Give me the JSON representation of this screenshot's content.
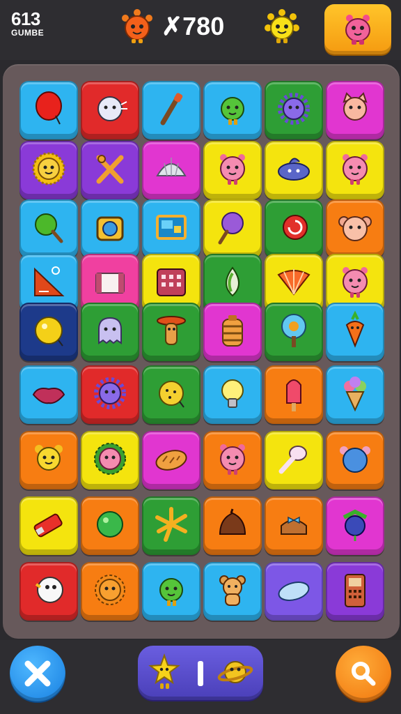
{
  "hud": {
    "score_value": "613",
    "score_caption": "GUMBE",
    "counter_text": "✗780",
    "left_mascot_icon": "orange-sun-creature-icon",
    "right_mascot_icon": "yellow-sun-creature-icon",
    "menu_icon": "pink-creature-icon"
  },
  "colors": {
    "cyan": "#2eb4f0",
    "red": "#e12a2a",
    "green": "#2e9e35",
    "magenta": "#e136d0",
    "purple": "#8a3ad8",
    "yellow": "#f4e40e",
    "orange": "#f77d12",
    "pink": "#f040a0",
    "navy": "#1d3a8a",
    "violet": "#7d57e6"
  },
  "board": {
    "rows": [
      [
        [
          "cyan",
          "balloon-icon"
        ],
        [
          "red",
          "fluffy-creature-icon"
        ],
        [
          "cyan",
          "brush-icon"
        ],
        [
          "cyan",
          "green-creature-icon"
        ],
        [
          "green",
          "purple-urchin-icon"
        ],
        [
          "magenta",
          "cat-face-icon"
        ]
      ],
      [
        [
          "purple",
          "sun-icon"
        ],
        [
          "purple",
          "crossed-sticks-icon"
        ],
        [
          "magenta",
          "shell-icon"
        ],
        [
          "yellow",
          "pink-creature-icon"
        ],
        [
          "yellow",
          "blob-creature-icon"
        ],
        [
          "yellow",
          "pink-creature-icon"
        ]
      ],
      [
        [
          "cyan",
          "green-lollipop-icon"
        ],
        [
          "cyan",
          "camera-icon"
        ],
        [
          "cyan",
          "picture-frame-icon"
        ],
        [
          "yellow",
          "purple-lollipop-icon"
        ],
        [
          "green",
          "red-snail-icon"
        ],
        [
          "orange",
          "bear-face-icon"
        ]
      ],
      [
        [
          "cyan",
          "ruler-icon"
        ],
        [
          "pink",
          "box-icon"
        ],
        [
          "yellow",
          "calculator-icon"
        ],
        [
          "green",
          "leaf-icon"
        ],
        [
          "yellow",
          "fan-icon"
        ],
        [
          "yellow",
          "pink-creature-icon"
        ]
      ],
      [
        [
          "navy",
          "yellow-ball-icon"
        ],
        [
          "green",
          "ghost-icon"
        ],
        [
          "green",
          "cowboy-icon"
        ],
        [
          "magenta",
          "barrel-icon"
        ],
        [
          "green",
          "tree-icon"
        ],
        [
          "cyan",
          "carrot-icon"
        ]
      ],
      [
        [
          "cyan",
          "lips-icon"
        ],
        [
          "red",
          "purple-urchin-icon"
        ],
        [
          "green",
          "yellow-cookie-icon"
        ],
        [
          "cyan",
          "lightbulb-icon"
        ],
        [
          "orange",
          "popsicle-icon"
        ],
        [
          "cyan",
          "ice-cream-icon"
        ]
      ],
      [
        [
          "orange",
          "yellow-creature-icon"
        ],
        [
          "yellow",
          "pink-flower-creature-icon"
        ],
        [
          "magenta",
          "bread-icon"
        ],
        [
          "orange",
          "pink-creature-icon"
        ],
        [
          "yellow",
          "spoon-icon"
        ],
        [
          "orange",
          "blue-creature-icon"
        ]
      ],
      [
        [
          "yellow",
          "battery-icon"
        ],
        [
          "orange",
          "green-ball-icon"
        ],
        [
          "green",
          "palm-leaf-icon"
        ],
        [
          "orange",
          "chestnut-icon"
        ],
        [
          "orange",
          "hat-icon"
        ],
        [
          "magenta",
          "berry-icon"
        ]
      ],
      [
        [
          "red",
          "egg-creature-icon"
        ],
        [
          "orange",
          "orange-creature-icon"
        ],
        [
          "cyan",
          "green-creature-icon"
        ],
        [
          "cyan",
          "bear-icon"
        ],
        [
          "violet",
          "capsule-icon"
        ],
        [
          "purple",
          "phone-icon"
        ]
      ]
    ]
  },
  "controls": {
    "close_icon": "close-icon",
    "power_left_icon": "star-creature-icon",
    "power_mid_icon": "divider-icon",
    "power_right_icon": "planet-icon",
    "search_icon": "search-icon"
  }
}
